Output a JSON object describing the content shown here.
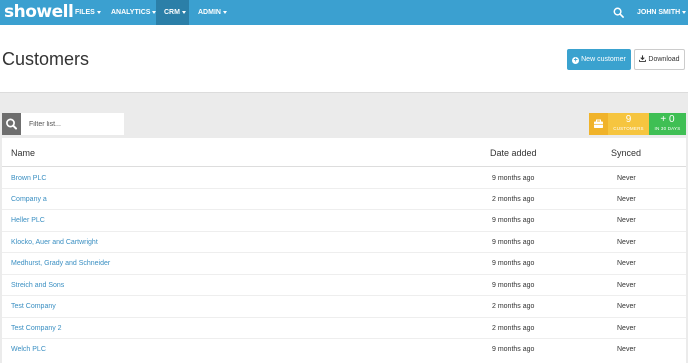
{
  "app": {
    "logo": "showell"
  },
  "nav": {
    "items": [
      {
        "label": "FILES"
      },
      {
        "label": "ANALYTICS"
      },
      {
        "label": "CRM"
      },
      {
        "label": "ADMIN"
      }
    ],
    "user": "JOHN SMITH"
  },
  "page": {
    "title": "Customers",
    "new_button": "New customer",
    "download_button": "Download"
  },
  "filter": {
    "placeholder": "Filter list..."
  },
  "stats": {
    "customers_count": "9",
    "customers_label": "CUSTOMERS",
    "new_count": "+ 0",
    "new_label": "IN 30 DAYS"
  },
  "table": {
    "columns": [
      "Name",
      "Date added",
      "Synced"
    ],
    "rows": [
      {
        "name": "Brown PLC",
        "date": "9 months ago",
        "synced": "Never"
      },
      {
        "name": "Company a",
        "date": "2 months ago",
        "synced": "Never"
      },
      {
        "name": "Heller PLC",
        "date": "9 months ago",
        "synced": "Never"
      },
      {
        "name": "Klocko, Auer and Cartwright",
        "date": "9 months ago",
        "synced": "Never"
      },
      {
        "name": "Medhurst, Grady and Schneider",
        "date": "9 months ago",
        "synced": "Never"
      },
      {
        "name": "Streich and Sons",
        "date": "9 months ago",
        "synced": "Never"
      },
      {
        "name": "Test Company",
        "date": "2 months ago",
        "synced": "Never"
      },
      {
        "name": "Test Company 2",
        "date": "2 months ago",
        "synced": "Never"
      },
      {
        "name": "Welch PLC",
        "date": "9 months ago",
        "synced": "Never"
      }
    ]
  }
}
